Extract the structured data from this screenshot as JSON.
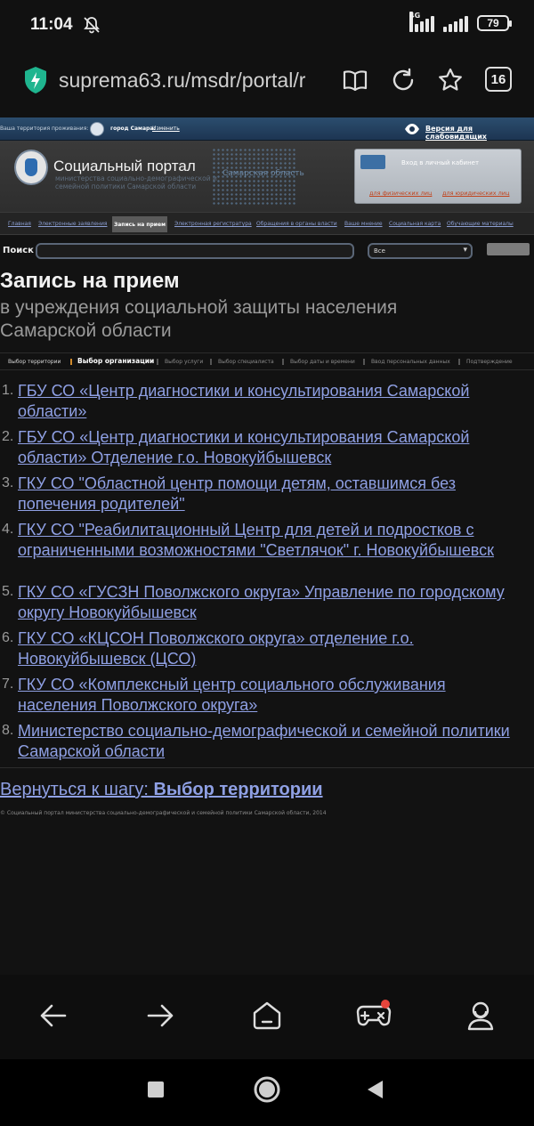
{
  "status": {
    "time": "11:04",
    "network": "4G",
    "battery": "79"
  },
  "address_bar": {
    "url": "suprema63.ru/msdr/portal/r",
    "tabs_count": "16"
  },
  "topstrip": {
    "territory_label": "Ваша территория проживания:",
    "city": "город Самара.",
    "change_link": "Изменить",
    "low_vision_link": "Версия для слабовидящих"
  },
  "header": {
    "title": "Социальный портал",
    "subtitle": "министерства социально-демографической и семейной политики Самарской области",
    "region": "Самарская область",
    "cabinet_title": "Вход в личный кабинет",
    "cabinet_individuals": "для физических лиц",
    "cabinet_legal": "для юридических лиц"
  },
  "nav": {
    "items": [
      "Главная",
      "Электронные заявления",
      "Запись на прием",
      "Электронная регистратура",
      "Обращения в органы власти",
      "Ваше мнение",
      "Социальная карта",
      "Обучающие материалы"
    ]
  },
  "search": {
    "label": "Поиск",
    "placeholder": "",
    "scope": "Все"
  },
  "page": {
    "title": "Запись на прием",
    "subtitle": "в учреждения социальной защиты населения Самарской области"
  },
  "steps": [
    "Выбор территории",
    "Выбор организации",
    "Выбор услуги",
    "Выбор специалиста",
    "Выбор даты и времени",
    "Ввод персональных данных",
    "Подтверждение"
  ],
  "organizations": [
    {
      "num": "1.",
      "name": "ГБУ СО «Центр диагностики и консультирования Самарской области»"
    },
    {
      "num": "2.",
      "name": "ГБУ СО «Центр диагностики и консультирования Самарской области» Отделение г.о. Новокуйбышевск"
    },
    {
      "num": "3.",
      "name": "ГКУ СО \"Областной центр помощи детям, оставшимся без попечения родителей\""
    },
    {
      "num": "4.",
      "name": "ГКУ СО \"Реабилитационный Центр для детей и подростков с ограниченными возможностями \"Светлячок\" г. Новокуйбышевск"
    },
    {
      "num": "5.",
      "name": "ГКУ СО «ГУСЗН Поволжского округа» Управление по городскому округу Новокуйбышевск"
    },
    {
      "num": "6.",
      "name": "ГКУ СО «КЦСОН Поволжского округа» отделение г.о. Новокуйбышевск (ЦСО)"
    },
    {
      "num": "7.",
      "name": "ГКУ СО «Комплексный центр социального обслуживания населения Поволжского округа»"
    },
    {
      "num": "8.",
      "name": "Министерство социально-демографической и семейной политики Самарской области"
    }
  ],
  "back": {
    "prefix": "Вернуться к шагу: ",
    "step": "Выбор территории"
  },
  "footer": "© Социальный портал министерства социально-демографической и семейной политики Самарской области, 2014",
  "colors": {
    "link": "#8fa0e4",
    "background": "#121212",
    "accent": "#d08a2c",
    "notification": "#e8453c"
  },
  "icons": {
    "status": [
      "mute-icon",
      "signal-icon",
      "battery-icon"
    ],
    "address_bar": [
      "shield-icon",
      "reader-mode-icon",
      "reload-icon",
      "star-icon"
    ],
    "toolbar": [
      "back-arrow-icon",
      "forward-arrow-icon",
      "home-icon",
      "game-icon",
      "profile-icon"
    ],
    "system": [
      "recents-icon",
      "home-circle-icon",
      "back-triangle-icon"
    ]
  }
}
